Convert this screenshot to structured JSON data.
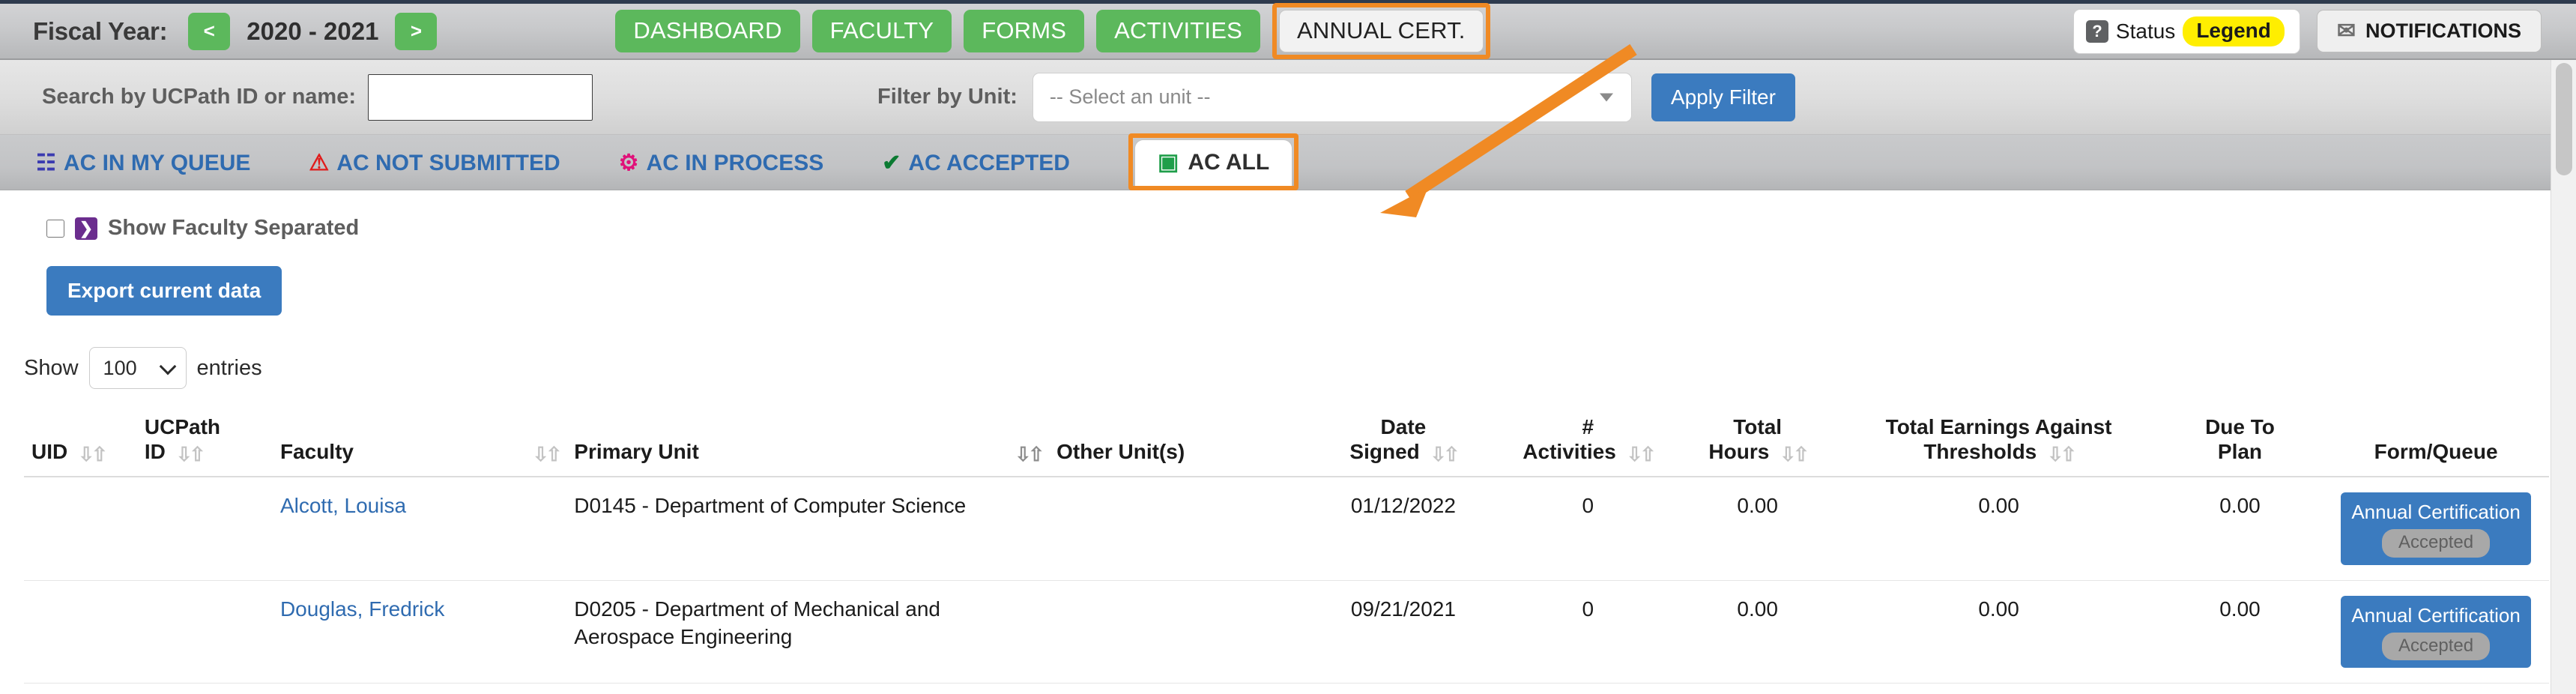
{
  "header": {
    "fiscal_year_label": "Fiscal Year:",
    "prev_label": "<",
    "next_label": ">",
    "fiscal_year_range": "2020 - 2021",
    "nav": [
      {
        "label": "DASHBOARD",
        "active": false
      },
      {
        "label": "FACULTY",
        "active": false
      },
      {
        "label": "FORMS",
        "active": false
      },
      {
        "label": "ACTIVITIES",
        "active": false
      },
      {
        "label": "ANNUAL CERT.",
        "active": true
      }
    ],
    "status_help_icon": "question-mark-icon",
    "status_label": "Status",
    "legend_label": "Legend",
    "notifications_icon": "envelope-icon",
    "notifications_label": "NOTIFICATIONS",
    "accent_orange": "#f08a24",
    "accent_green": "#5cb85c",
    "legend_yellow": "#ffee00"
  },
  "filters": {
    "search_label": "Search by UCPath ID or name:",
    "search_value": "",
    "search_placeholder": "",
    "unit_label": "Filter by Unit:",
    "unit_selected": "-- Select an unit --",
    "unit_caret_icon": "chevron-down-icon",
    "apply_label": "Apply Filter",
    "apply_color": "#3b7bbf"
  },
  "tabs": [
    {
      "label": "AC IN MY QUEUE",
      "icon": "calendar-icon",
      "glyph": "☷",
      "color": "#3b3bb0",
      "active": false
    },
    {
      "label": "AC NOT SUBMITTED",
      "icon": "warning-triangle-icon",
      "glyph": "⚠",
      "color": "#e01b1b",
      "active": false
    },
    {
      "label": "AC IN PROCESS",
      "icon": "gear-icon",
      "glyph": "⚙",
      "color": "#e0127a",
      "active": false
    },
    {
      "label": "AC ACCEPTED",
      "icon": "check-icon",
      "glyph": "✔",
      "color": "#0b7a32",
      "active": false
    },
    {
      "label": "AC ALL",
      "icon": "stacked-pages-icon",
      "glyph": "▣",
      "color": "#1f9e4a",
      "active": true
    }
  ],
  "controls": {
    "show_faculty_separated_label": "Show Faculty Separated",
    "show_faculty_separated_checked": false,
    "separated_glyph": "❯",
    "export_label": "Export current data",
    "show_label": "Show",
    "entries_label": "entries",
    "page_length": "100"
  },
  "table": {
    "columns": [
      {
        "label": "UID",
        "sub": "",
        "align": "l",
        "sort": "both"
      },
      {
        "label": "ID",
        "sub": "UCPath",
        "align": "l",
        "sort": "both"
      },
      {
        "label": "Faculty",
        "sub": "",
        "align": "l",
        "sort": "both"
      },
      {
        "label": "Primary Unit",
        "sub": "",
        "align": "l",
        "sort": "asc"
      },
      {
        "label": "Other Unit(s)",
        "sub": "",
        "align": "l",
        "sort": "none"
      },
      {
        "label": "Signed",
        "sub": "Date",
        "align": "c",
        "sort": "both"
      },
      {
        "label": "Activities",
        "sub": "#",
        "align": "c",
        "sort": "both"
      },
      {
        "label": "Hours",
        "sub": "Total",
        "align": "c",
        "sort": "both"
      },
      {
        "label": "Thresholds",
        "sub": "Total Earnings Against",
        "align": "c",
        "sort": "both"
      },
      {
        "label": "Plan",
        "sub": "Due To",
        "align": "c",
        "sort": "both"
      },
      {
        "label": "Form/Queue",
        "sub": "",
        "align": "c",
        "sort": "none"
      }
    ],
    "rows": [
      {
        "uid": "",
        "ucpath_id": "",
        "faculty": "Alcott, Louisa",
        "primary_unit": "D0145 - Department of Computer Science",
        "other_units": "",
        "date_signed": "01/12/2022",
        "num_activities": "0",
        "total_hours": "0.00",
        "total_earnings": "0.00",
        "due_to_plan": "0.00",
        "form_label": "Annual Certification",
        "form_status": "Accepted"
      },
      {
        "uid": "",
        "ucpath_id": "",
        "faculty": "Douglas, Fredrick",
        "primary_unit": "D0205 - Department of Mechanical and Aerospace Engineering",
        "other_units": "",
        "date_signed": "09/21/2021",
        "num_activities": "0",
        "total_hours": "0.00",
        "total_earnings": "0.00",
        "due_to_plan": "0.00",
        "form_label": "Annual Certification",
        "form_status": "Accepted"
      }
    ]
  }
}
